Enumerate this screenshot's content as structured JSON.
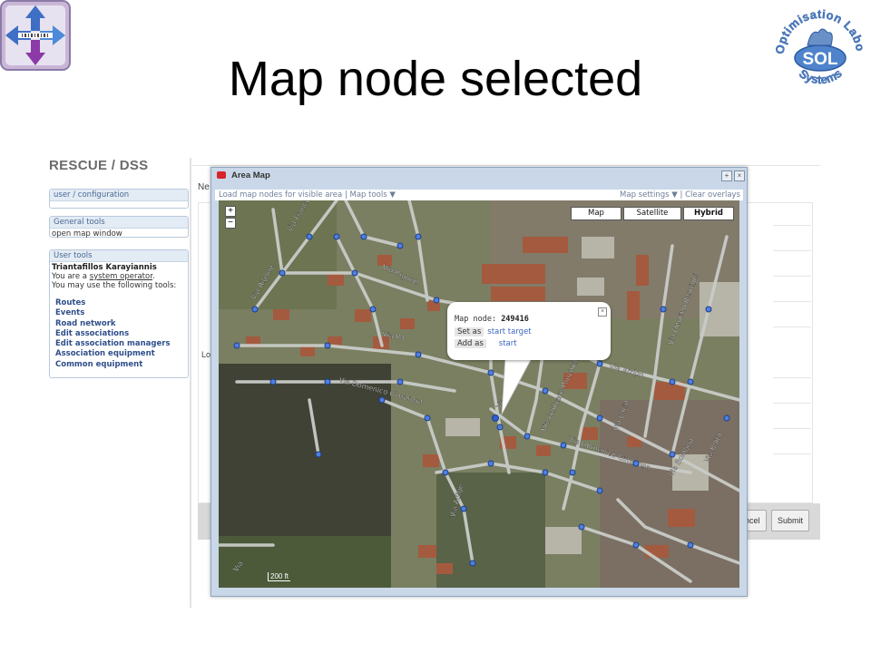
{
  "slide": {
    "title": "Map node selected"
  },
  "logos": {
    "left": {
      "icon": "arrows-logo-icon"
    },
    "right": {
      "text_top": "Optimisation Laboratory",
      "text_bottom": "Systems",
      "center": "SOL"
    }
  },
  "app": {
    "title": "RESCUE / DSS",
    "panels": {
      "user_config": {
        "header": "user / configuration"
      },
      "general_tools": {
        "header": "General tools",
        "link": "open map window"
      },
      "user_tools": {
        "header": "User tools",
        "user_name": "Triantafillos Karayiannis",
        "role_prefix": "You are a",
        "role": "system operator",
        "role_suffix": ".",
        "tools_intro": "You may use the following tools:",
        "items": [
          "Routes",
          "Events",
          "Road network",
          "Edit associations",
          "Edit association managers",
          "Association equipment",
          "Common equipment"
        ]
      }
    },
    "background_form": {
      "label_ne": "Ne",
      "label_lo": "Lo",
      "cancel_label": "ncel",
      "submit_label": "Submit"
    }
  },
  "dialog": {
    "title": "Area Map",
    "toolbar_left": "Load map nodes for visible area | Map tools ▼",
    "toolbar_right": "Map settings ▼ | Clear overlays",
    "map_types": [
      "Map",
      "Satellite",
      "Hybrid"
    ],
    "selected_map_type": "Hybrid",
    "zoom_in": "+",
    "zoom_out": "−",
    "scale": "200 ft",
    "streets": [
      "Via Francesco",
      "Via Rigone",
      "Via Rigone",
      "Via Po",
      "Via Domenico Cimarosa",
      "Via Ruggero",
      "Via Amilcare Ponchielli",
      "Via Lucia",
      "Via Domenico Cimarosa",
      "Via Bologna",
      "Via Onorino Respighi",
      "Via Arrigo",
      "Via Boito",
      "Via Adige",
      "Via"
    ],
    "balloon": {
      "title_label": "Map node:",
      "node_id": "249416",
      "set_as_label": "Set as",
      "start_target_link": "start target",
      "add_as_label": "Add as",
      "start_link": "start"
    }
  }
}
